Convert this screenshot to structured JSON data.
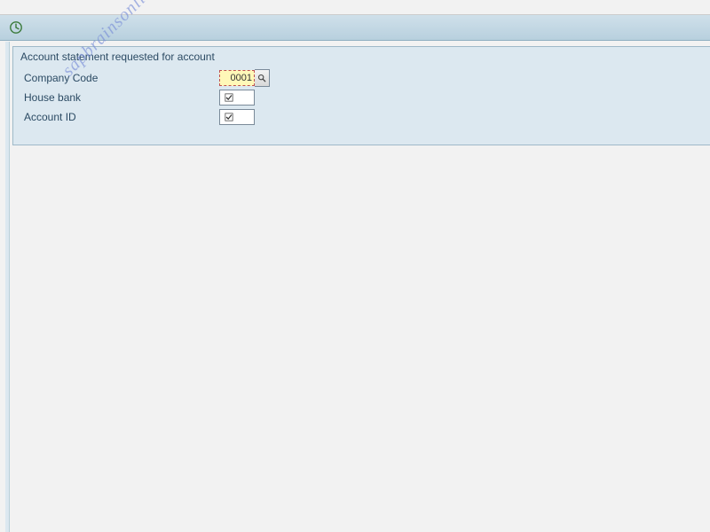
{
  "toolbar": {
    "execute_tooltip": "Execute"
  },
  "groupbox": {
    "title": "Account statement requested for account",
    "fields": {
      "company_code": {
        "label": "Company Code",
        "value": "0001"
      },
      "house_bank": {
        "label": "House bank",
        "value": ""
      },
      "account_id": {
        "label": "Account ID",
        "value": ""
      }
    }
  },
  "watermark": "sapbrainsonline.com"
}
